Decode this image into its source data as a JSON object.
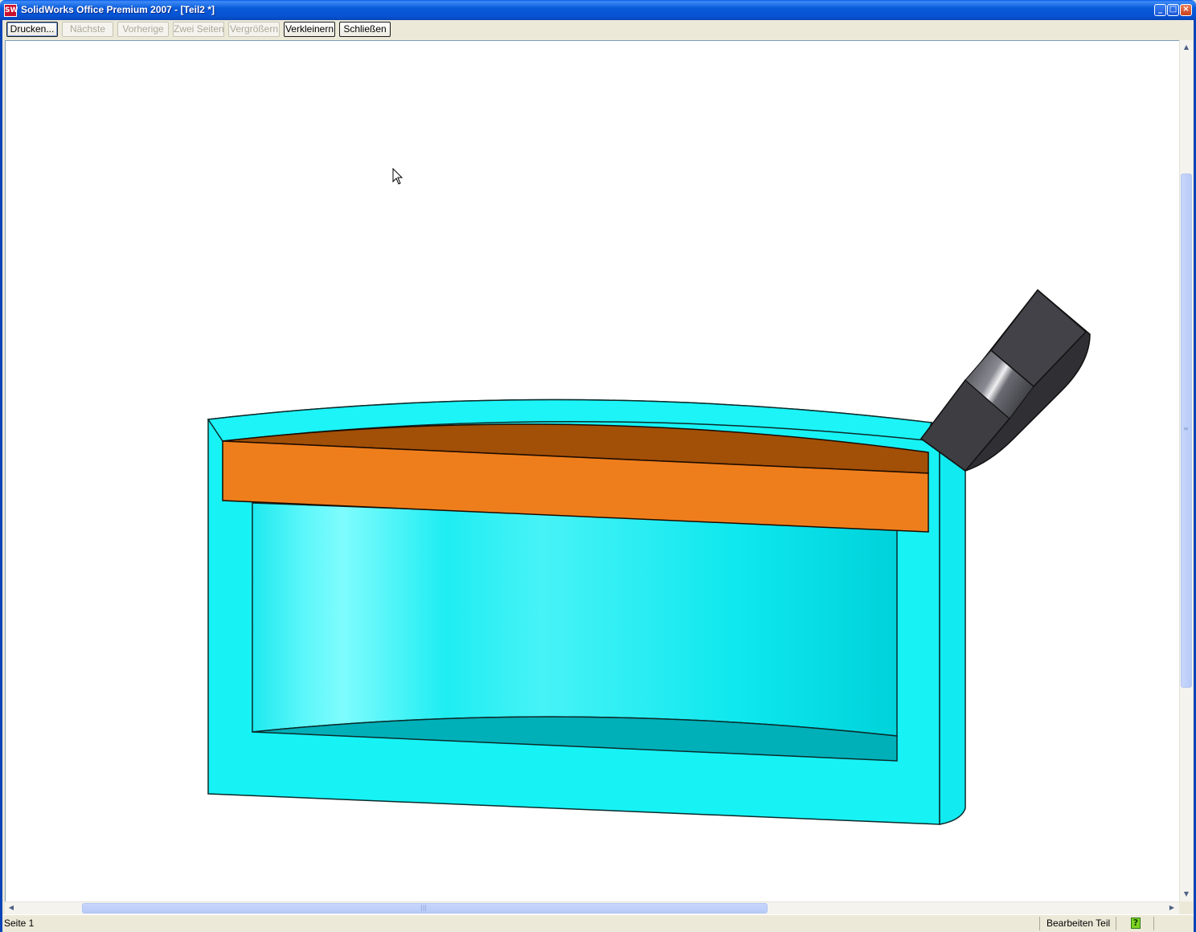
{
  "window": {
    "title": "SolidWorks Office Premium 2007 - [Teil2 *]",
    "app_icon_text": "SW"
  },
  "toolbar": {
    "print_label": "Drucken...",
    "next_label": "Nächste",
    "previous_label": "Vorherige",
    "two_pages_label": "Zwei Seiten",
    "zoom_in_label": "Vergrößern",
    "zoom_out_label": "Verkleinern",
    "close_label": "Schließen"
  },
  "status": {
    "page": "Seite 1",
    "mode": "Bearbeiten Teil"
  },
  "colors": {
    "cyan_body": "#17f2f5",
    "cyan_shadow": "#00b0b8",
    "orange_front": "#ee7e1c",
    "orange_top": "#a24f07",
    "handle_dark": "#3d3d42"
  },
  "icons": {
    "app": "solidworks-logo-icon",
    "help": "help-question-icon",
    "cursor": "mouse-pointer-icon"
  }
}
